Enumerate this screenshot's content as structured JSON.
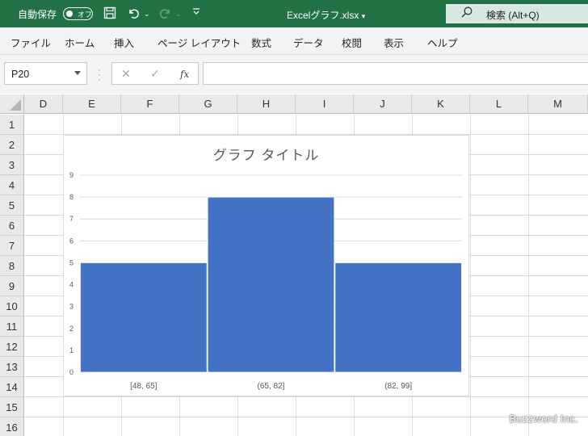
{
  "titlebar": {
    "autosave_label": "自動保存",
    "toggle_label": "オフ",
    "filename": "Excelグラフ.xlsx",
    "search_label": "検索 (Alt+Q)"
  },
  "menu": {
    "items": [
      {
        "label": "ファイル"
      },
      {
        "label": "ホーム"
      },
      {
        "label": "挿入"
      },
      {
        "label": "ページ レイアウト"
      },
      {
        "label": "数式"
      },
      {
        "label": "データ"
      },
      {
        "label": "校閲"
      },
      {
        "label": "表示"
      },
      {
        "label": "ヘルプ"
      }
    ]
  },
  "formula": {
    "namebox": "P20",
    "fx": "fx",
    "value": ""
  },
  "grid": {
    "columns": [
      "D",
      "E",
      "F",
      "G",
      "H",
      "I",
      "J",
      "K",
      "L",
      "M"
    ],
    "rows": [
      "1",
      "2",
      "3",
      "4",
      "5",
      "6",
      "7",
      "8",
      "9",
      "10",
      "11",
      "12",
      "13",
      "14",
      "15",
      "16"
    ]
  },
  "chart_data": {
    "type": "bar",
    "title": "グラフ タイトル",
    "categories": [
      "[48, 65]",
      "(65, 82]",
      "(82, 99]"
    ],
    "values": [
      5,
      8,
      5
    ],
    "ylim": [
      0,
      9
    ],
    "yticks": [
      "0",
      "1",
      "2",
      "3",
      "4",
      "5",
      "6",
      "7",
      "8",
      "9"
    ],
    "grid": true,
    "bar_color": "#4472c4",
    "xlabel": "",
    "ylabel": ""
  },
  "watermark": "Buzzword Inc."
}
